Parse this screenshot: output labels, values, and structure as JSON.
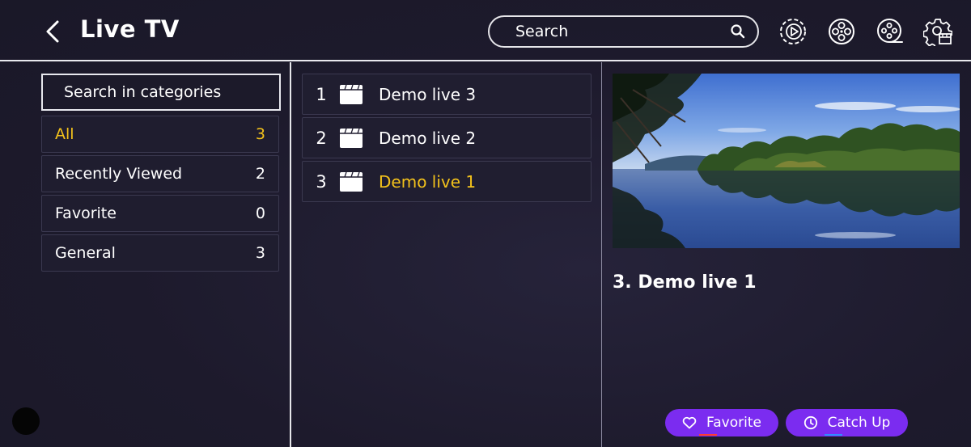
{
  "header": {
    "title": "Live TV",
    "search_placeholder": "Search",
    "icons": [
      "back-arrow-icon",
      "search-icon",
      "play-circle-icon",
      "film-reel-icon",
      "movie-reel-icon",
      "settings-gear-icon"
    ]
  },
  "categories": {
    "search_placeholder": "Search in categories",
    "items": [
      {
        "label": "All",
        "count": "3",
        "active": true
      },
      {
        "label": "Recently Viewed",
        "count": "2"
      },
      {
        "label": "Favorite",
        "count": "0"
      },
      {
        "label": "General",
        "count": "3"
      }
    ]
  },
  "channels": [
    {
      "number": "1",
      "name": "Demo live 3"
    },
    {
      "number": "2",
      "name": "Demo live 2"
    },
    {
      "number": "3",
      "name": "Demo live 1",
      "active": true
    }
  ],
  "now_playing": {
    "title": "3.  Demo live 1"
  },
  "actions": {
    "favorite_label": "Favorite",
    "catchup_label": "Catch Up"
  },
  "colors": {
    "accent_yellow": "#f3c21b",
    "button_purple": "#7b2cf0",
    "background": "#1e1b2e"
  }
}
